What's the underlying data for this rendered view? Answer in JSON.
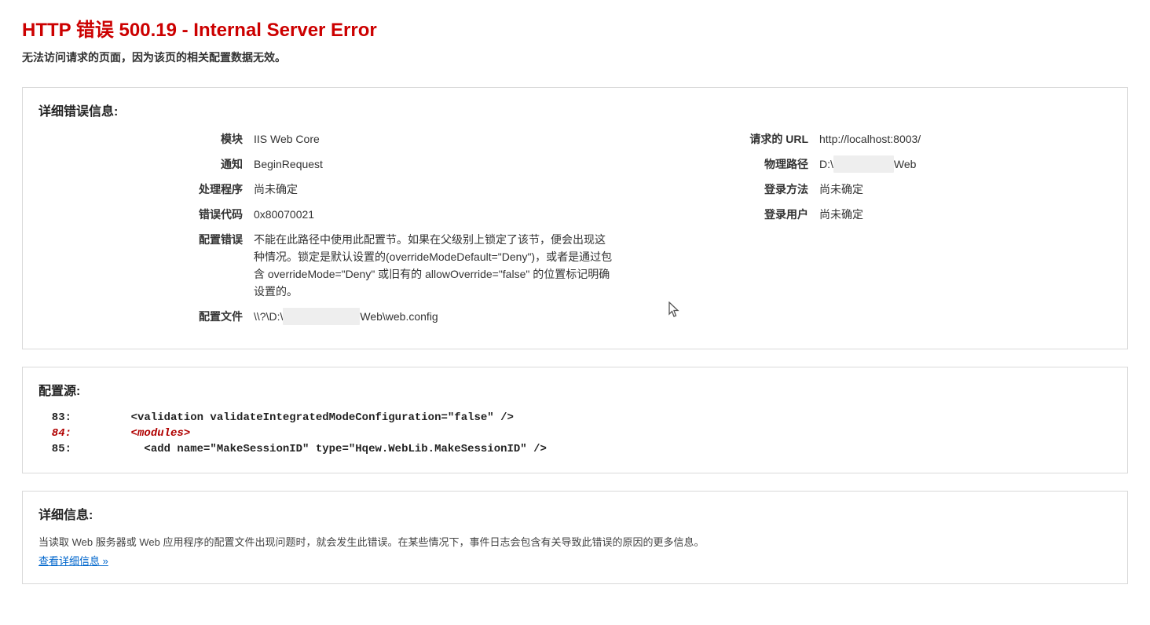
{
  "header": {
    "title": "HTTP 错误 500.19 - Internal Server Error",
    "subtitle": "无法访问请求的页面，因为该页的相关配置数据无效。"
  },
  "details": {
    "panel_title": "详细错误信息:",
    "left": {
      "module_label": "模块",
      "module_value": "IIS Web Core",
      "notify_label": "通知",
      "notify_value": "BeginRequest",
      "handler_label": "处理程序",
      "handler_value": "尚未确定",
      "errcode_label": "错误代码",
      "errcode_value": "0x80070021",
      "cfgerr_label": "配置错误",
      "cfgerr_value": "不能在此路径中使用此配置节。如果在父级别上锁定了该节，便会出现这种情况。锁定是默认设置的(overrideModeDefault=\"Deny\")，或者是通过包含 overrideMode=\"Deny\" 或旧有的 allowOverride=\"false\" 的位置标记明确设置的。",
      "cfgfile_label": "配置文件",
      "cfgfile_prefix": "\\\\?\\D:\\",
      "cfgfile_suffix": "Web\\web.config"
    },
    "right": {
      "url_label": "请求的 URL",
      "url_value": "http://localhost:8003/",
      "path_label": "物理路径",
      "path_prefix": "D:\\",
      "path_suffix": "Web",
      "login_method_label": "登录方法",
      "login_method_value": "尚未确定",
      "login_user_label": "登录用户",
      "login_user_value": "尚未确定"
    }
  },
  "config_source": {
    "panel_title": "配置源:",
    "lines": [
      {
        "no": "83:",
        "text": "    <validation validateIntegratedModeConfiguration=\"false\" />",
        "err": false
      },
      {
        "no": "84:",
        "text": "    <modules>",
        "err": true
      },
      {
        "no": "85:",
        "text": "      <add name=\"MakeSessionID\" type=\"Hqew.WebLib.MakeSessionID\" />",
        "err": false
      }
    ]
  },
  "more": {
    "panel_title": "详细信息:",
    "text": "当读取 Web 服务器或 Web 应用程序的配置文件出现问题时，就会发生此错误。在某些情况下，事件日志会包含有关导致此错误的原因的更多信息。",
    "link": "查看详细信息 »"
  }
}
